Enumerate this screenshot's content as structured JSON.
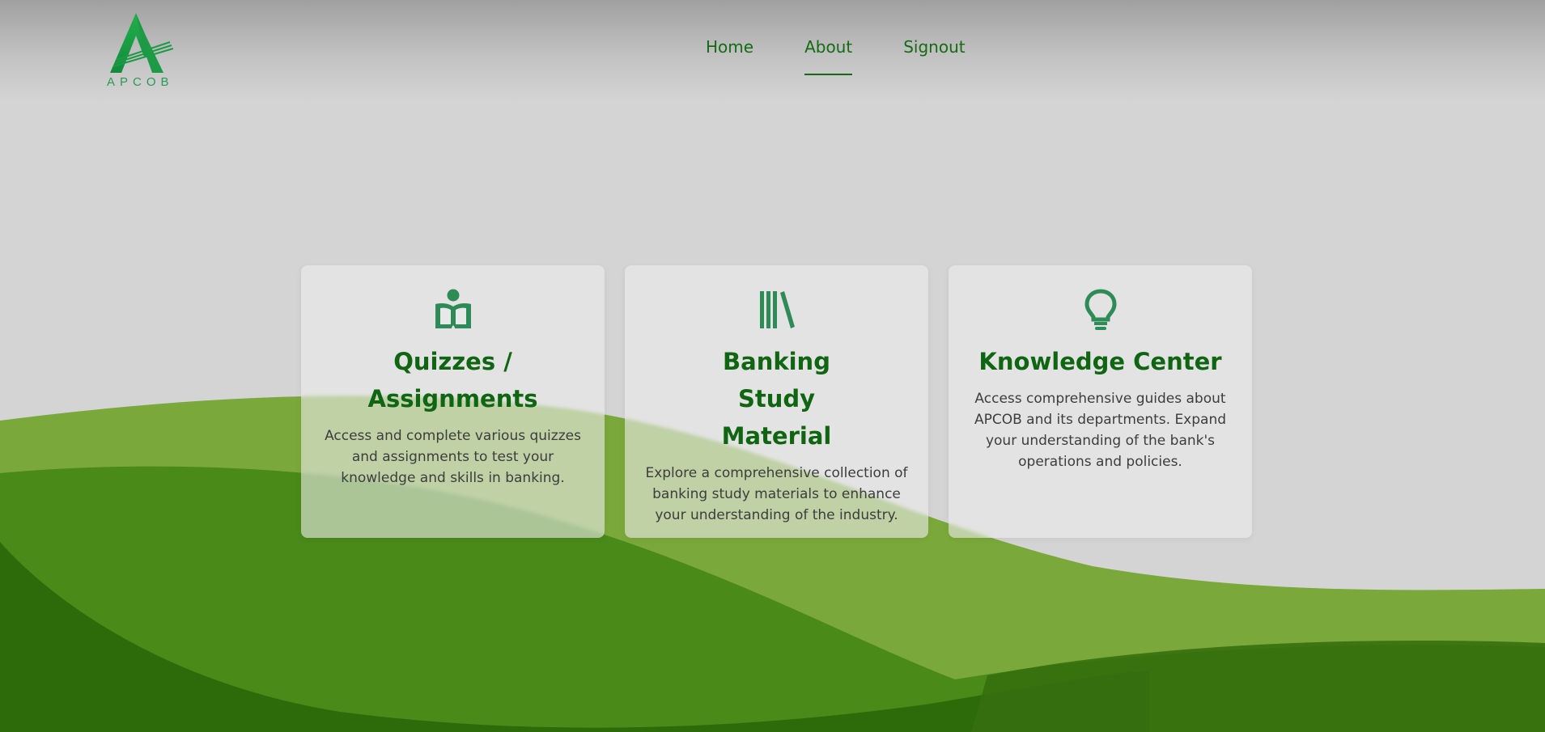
{
  "brand": {
    "logo_text": "APCOB",
    "color": "#1f9a4a"
  },
  "nav": {
    "items": [
      {
        "label": "Home",
        "active": false
      },
      {
        "label": "About",
        "active": true
      },
      {
        "label": "Signout",
        "active": false
      }
    ]
  },
  "cards": [
    {
      "icon": "book-reader-icon",
      "title": "Quizzes / Assignments",
      "description": "Access and complete various quizzes and assignments to test your knowledge and skills in banking."
    },
    {
      "icon": "book-shelf-icon",
      "title": "Banking Study Material",
      "description": "Explore a comprehensive collection of banking study materials to enhance your understanding of the industry."
    },
    {
      "icon": "lightbulb-icon",
      "title": "Knowledge Center",
      "description": "Access comprehensive guides about APCOB and its departments. Expand your understanding of the bank's operations and policies."
    }
  ],
  "colors": {
    "heading": "#0f6511",
    "icon": "#2e8b57",
    "wave_light": "#7aa83a",
    "wave_mid": "#4a8a18",
    "wave_dark": "#2d6b0a"
  }
}
